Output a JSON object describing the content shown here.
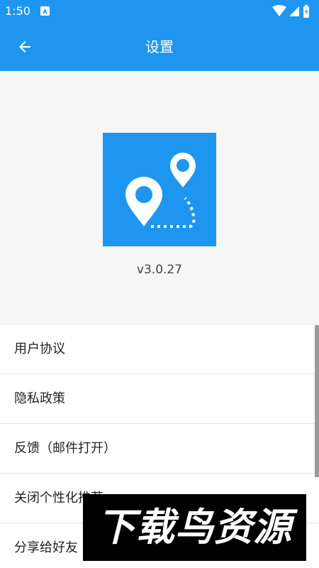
{
  "status_bar": {
    "time": "1:50",
    "icons": [
      "notification-a-icon",
      "wifi-icon",
      "signal-icon",
      "battery-icon"
    ]
  },
  "app_bar": {
    "title": "设置",
    "back_icon": "arrow-left-icon"
  },
  "header": {
    "logo_icon": "route-map-pins-icon",
    "version": "v3.0.27"
  },
  "menu": {
    "items": [
      {
        "label": "用户协议"
      },
      {
        "label": "隐私政策"
      },
      {
        "label": "反馈（邮件打开）"
      },
      {
        "label": "关闭个性化推荐"
      },
      {
        "label": "分享给好友"
      }
    ]
  },
  "watermark": {
    "text": "下载鸟资源"
  },
  "colors": {
    "primary": "#1e96f0",
    "header_bg": "#f6f6f6",
    "divider": "#e4e4e4",
    "text": "#222222",
    "version_text": "#444444"
  }
}
